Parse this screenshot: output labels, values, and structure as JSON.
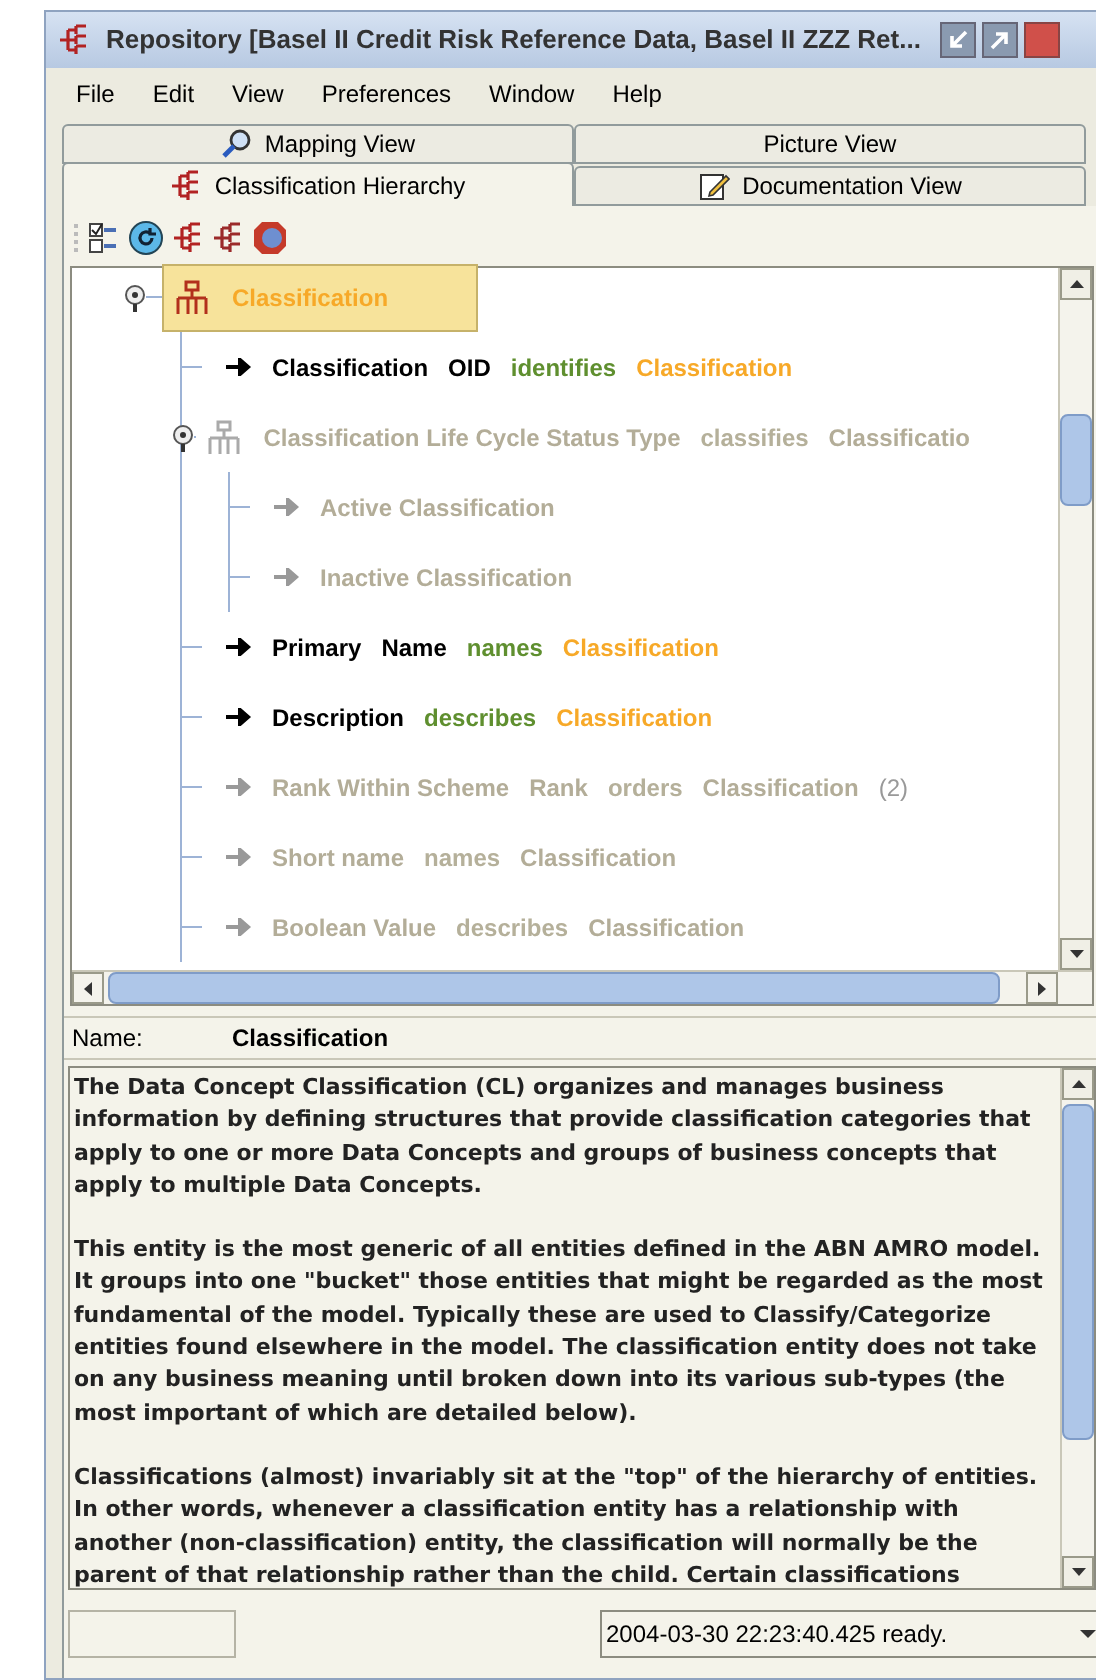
{
  "window": {
    "title": "Repository [Basel II Credit Risk Reference Data, Basel II ZZZ Ret..."
  },
  "menu": [
    "File",
    "Edit",
    "View",
    "Preferences",
    "Window",
    "Help"
  ],
  "tabs_back_row": [
    {
      "label": "Mapping View",
      "kind": "search",
      "selected": false
    },
    {
      "label": "Picture View",
      "kind": "none",
      "selected": false
    }
  ],
  "tabs_front_row": [
    {
      "label": "Classification Hierarchy",
      "kind": "hierarchy",
      "selected": true
    },
    {
      "label": "Documentation View",
      "kind": "edit",
      "selected": false
    }
  ],
  "tree": {
    "kind": "group",
    "enabled": true,
    "selected": true,
    "expanded": true,
    "parts": [
      {
        "text": "Classification",
        "kind": "target"
      }
    ],
    "children": [
      {
        "kind": "attribute",
        "enabled": true,
        "selected": false,
        "parts": [
          {
            "text": "Classification",
            "kind": "name"
          },
          {
            "text": "OID",
            "kind": "name"
          },
          {
            "text": "identifies",
            "kind": "verb"
          },
          {
            "text": "Classification",
            "kind": "target"
          }
        ]
      },
      {
        "kind": "group",
        "enabled": false,
        "selected": false,
        "expanded": true,
        "parts": [
          {
            "text": "Classification Life Cycle Status Type",
            "kind": "name"
          },
          {
            "text": "classifies",
            "kind": "verb"
          },
          {
            "text": "Classificatio",
            "kind": "target"
          }
        ],
        "children": [
          {
            "kind": "attribute",
            "enabled": false,
            "selected": false,
            "parts": [
              {
                "text": "Active Classification",
                "kind": "name"
              }
            ]
          },
          {
            "kind": "attribute",
            "enabled": false,
            "selected": false,
            "parts": [
              {
                "text": "Inactive Classification",
                "kind": "name"
              }
            ]
          }
        ]
      },
      {
        "kind": "attribute",
        "enabled": true,
        "selected": false,
        "parts": [
          {
            "text": "Primary",
            "kind": "name"
          },
          {
            "text": "Name",
            "kind": "name"
          },
          {
            "text": "names",
            "kind": "verb"
          },
          {
            "text": "Classification",
            "kind": "target"
          }
        ]
      },
      {
        "kind": "attribute",
        "enabled": true,
        "selected": false,
        "parts": [
          {
            "text": "Description",
            "kind": "name"
          },
          {
            "text": "describes",
            "kind": "verb"
          },
          {
            "text": "Classification",
            "kind": "target"
          }
        ]
      },
      {
        "kind": "attribute",
        "enabled": false,
        "selected": false,
        "parts": [
          {
            "text": "Rank Within Scheme",
            "kind": "name"
          },
          {
            "text": "Rank",
            "kind": "name"
          },
          {
            "text": "orders",
            "kind": "verb"
          },
          {
            "text": "Classification",
            "kind": "target"
          },
          {
            "text": "(2)",
            "kind": "count"
          }
        ]
      },
      {
        "kind": "attribute",
        "enabled": false,
        "selected": false,
        "parts": [
          {
            "text": "Short name",
            "kind": "name"
          },
          {
            "text": "names",
            "kind": "verb"
          },
          {
            "text": "Classification",
            "kind": "target"
          }
        ]
      },
      {
        "kind": "attribute",
        "enabled": false,
        "selected": false,
        "parts": [
          {
            "text": "Boolean Value",
            "kind": "name"
          },
          {
            "text": "describes",
            "kind": "verb"
          },
          {
            "text": "Classification",
            "kind": "target"
          }
        ]
      }
    ]
  },
  "name_field": {
    "label": "Name:",
    "value": "Classification"
  },
  "description": {
    "paragraphs": [
      "The Data Concept Classification (CL) organizes and manages business information by defining structures that provide classification categories that apply to one or more Data Concepts and groups of business concepts that apply to multiple Data Concepts.",
      "This entity is the most generic of all entities defined in the ABN AMRO model. It groups into one \"bucket\" those entities that might be regarded as the most fundamental of the model. Typically these are used to Classify/Categorize entities found elsewhere in the model. The classification entity does not take on any business meaning until broken down into its various sub-types (the most important of which are detailed below).",
      "Classifications (almost) invariably sit at the \"top\" of the hierarchy of entities. In other words, whenever a classification entity has a relationship with another (non-classification) entity, the classification will normally be the parent of that relationship rather than the child. Certain classifications"
    ]
  },
  "status_bar": {
    "message": "2004-03-30 22:23:40.425 ready."
  }
}
